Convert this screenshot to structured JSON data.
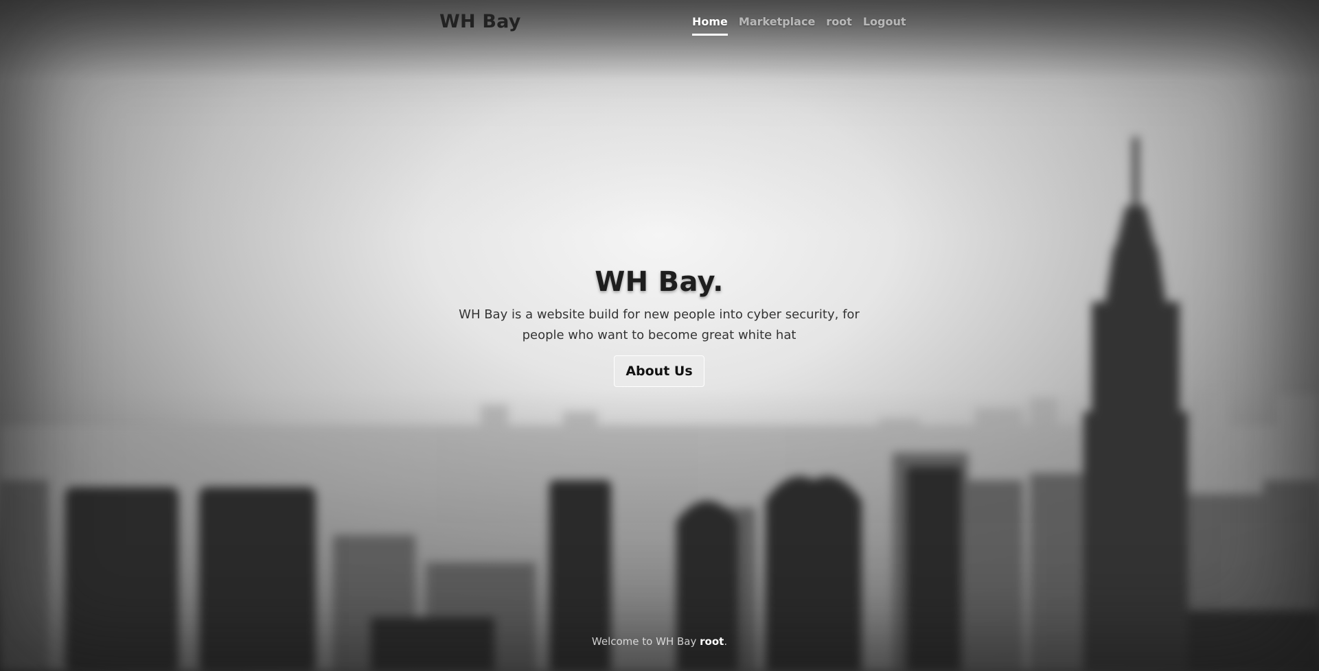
{
  "header": {
    "brand": "WH Bay",
    "nav": [
      {
        "label": "Home",
        "active": true
      },
      {
        "label": "Marketplace",
        "active": false
      },
      {
        "label": "root",
        "active": false
      },
      {
        "label": "Logout",
        "active": false
      }
    ]
  },
  "hero": {
    "title": "WH Bay.",
    "lead": "WH Bay is a website build for new people into cyber security, for people who want to become great white hat",
    "button_label": "About Us"
  },
  "footer": {
    "prefix": "Welcome to WH Bay ",
    "user": "root",
    "suffix": "."
  },
  "theme": {
    "nav_active": "#ffffff",
    "nav_inactive": "#bdbdbd",
    "title_color": "#1e1e1e"
  }
}
